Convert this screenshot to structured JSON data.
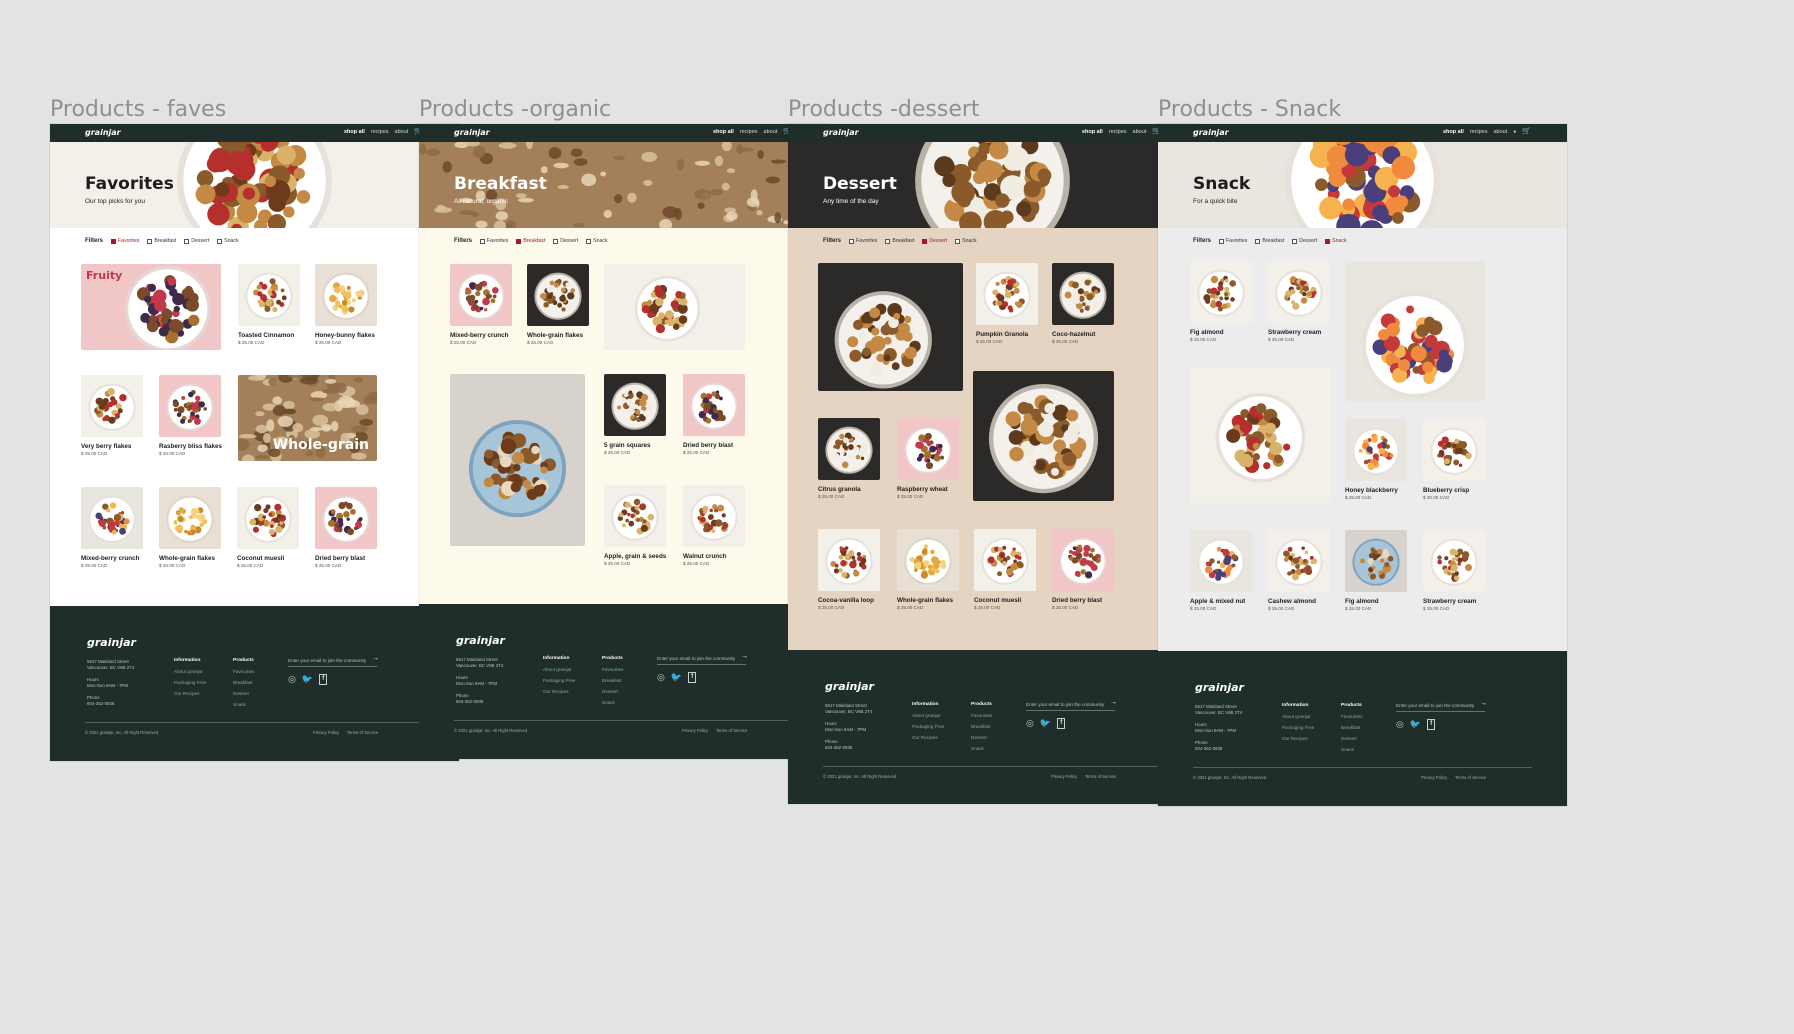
{
  "common": {
    "logo": "grainjar",
    "nav": [
      "shop all",
      "recipes",
      "about"
    ],
    "filters_label": "Filters",
    "filter_options": [
      "Favorites",
      "Breakfast",
      "Dessert",
      "Snack"
    ],
    "footer": {
      "logo": "grainjar",
      "address": [
        "5617 Mainland Street",
        "Vancouver, BC V6B 2T4"
      ],
      "hours_label": "Hours",
      "hours": "Mon-Sun 9AM - 7PM",
      "phone_label": "Phone",
      "phone": "604-352-0938",
      "info_heading": "Information",
      "info_links": [
        "About grainjar",
        "Packaging Free",
        "Our Recipes"
      ],
      "products_heading": "Products",
      "product_links": [
        "Favourites",
        "Breakfast",
        "Dessert",
        "Snack"
      ],
      "email_placeholder": "Enter your email to join the community",
      "arrow": "→",
      "social": [
        "instagram-icon",
        "twitter-icon",
        "facebook-icon"
      ],
      "copyright": "© 2021 grainjar, Inc. All Right Reserved",
      "privacy": "Privacy Policy",
      "terms": "Terms of Service"
    }
  },
  "pages": [
    {
      "frame_title": "Products - faves",
      "hero_title": "Favorites",
      "hero_subtitle": "Our top picks for you",
      "active_filter": 0,
      "products": [
        {
          "name": "Toasted Cinnamon",
          "price": "$ 25.00 CAD"
        },
        {
          "name": "Honey-bunny flakes",
          "price": "$ 25.00 CAD"
        },
        {
          "name": "Very berry flakes",
          "price": "$ 25.00 CAD"
        },
        {
          "name": "Rasberry bliss flakes",
          "price": "$ 25.00 CAD"
        },
        {
          "name": "Mixed-berry crunch",
          "price": "$ 25.00 CAD"
        },
        {
          "name": "Whole-grain flakes",
          "price": "$ 25.00 CAD"
        },
        {
          "name": "Coconut muesli",
          "price": "$ 25.00 CAD"
        },
        {
          "name": "Dried berry blast",
          "price": "$ 25.00 CAD"
        }
      ],
      "promo_labels": [
        "Fruity",
        "Whole-grain"
      ]
    },
    {
      "frame_title": "Products -organic",
      "hero_title": "Breakfast",
      "hero_subtitle": "All natural, organic",
      "active_filter": 1,
      "products": [
        {
          "name": "Mixed-berry crunch",
          "price": "$ 25.00 CAD"
        },
        {
          "name": "Whole-grain flakes",
          "price": "$ 25.00 CAD"
        },
        {
          "name": "5 grain squares",
          "price": "$ 25.00 CAD"
        },
        {
          "name": "Dried berry blast",
          "price": "$ 25.00 CAD"
        },
        {
          "name": "Apple, grain & seeds",
          "price": "$ 25.00 CAD"
        },
        {
          "name": "Walnut crunch",
          "price": "$ 25.00 CAD"
        }
      ]
    },
    {
      "frame_title": "Products -dessert",
      "hero_title": "Dessert",
      "hero_subtitle": "Any time of the day",
      "active_filter": 2,
      "products": [
        {
          "name": "Pumpkin Granola",
          "price": "$ 25.00 CAD"
        },
        {
          "name": "Coco-hazelnut",
          "price": "$ 25.00 CAD"
        },
        {
          "name": "Citrus granola",
          "price": "$ 25.00 CAD"
        },
        {
          "name": "Raspberry wheat",
          "price": "$ 25.00 CAD"
        },
        {
          "name": "Cocoa-vanilla loop",
          "price": "$ 25.00 CAD"
        },
        {
          "name": "Whole-grain flakes",
          "price": "$ 25.00 CAD"
        },
        {
          "name": "Coconut muesli",
          "price": "$ 25.00 CAD"
        },
        {
          "name": "Dried berry blast",
          "price": "$ 25.00 CAD"
        }
      ]
    },
    {
      "frame_title": "Products - Snack",
      "hero_title": "Snack",
      "hero_subtitle": "For a quick bite",
      "active_filter": 3,
      "products": [
        {
          "name": "Fig almond",
          "price": "$ 25.00 CAD"
        },
        {
          "name": "Strawberry cream",
          "price": "$ 25.00 CAD"
        },
        {
          "name": "Honey blackberry",
          "price": "$ 25.00 CAD"
        },
        {
          "name": "Blueberry crisp",
          "price": "$ 25.00 CAD"
        },
        {
          "name": "Apple & mixed nut",
          "price": "$ 25.00 CAD"
        },
        {
          "name": "Cashew almond",
          "price": "$ 25.00 CAD"
        },
        {
          "name": "Fig almond",
          "price": "$ 25.00 CAD"
        },
        {
          "name": "Strawberry cream",
          "price": "$ 25.00 CAD"
        }
      ]
    }
  ],
  "colors": {
    "nav_bg": "#1f2e2a",
    "footer_bg": "#1f2e2a",
    "accent": "#a51a2b",
    "page_faves_bg": "#ffffff",
    "page_organic_bg": "#fdfaec",
    "page_dessert_bg": "#e5d4c1",
    "page_snack_bg": "#ececec"
  }
}
